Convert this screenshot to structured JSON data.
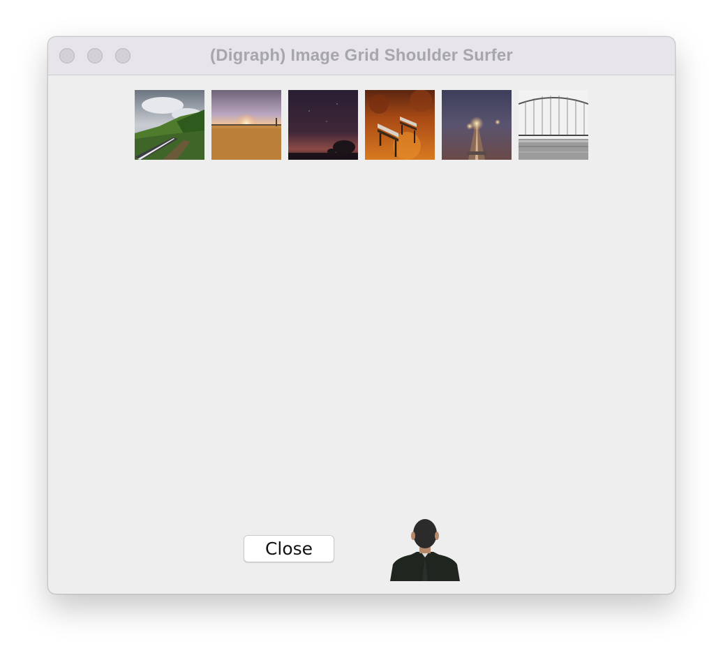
{
  "window": {
    "title": "(Digraph) Image Grid Shoulder Surfer"
  },
  "image_grid": {
    "images": [
      {
        "icon": "mountain-road-photo"
      },
      {
        "icon": "sunset-field-photo"
      },
      {
        "icon": "night-sky-tree-photo"
      },
      {
        "icon": "autumn-benches-photo"
      },
      {
        "icon": "foggy-road-lights-photo"
      },
      {
        "icon": "bridge-water-photo"
      }
    ]
  },
  "footer": {
    "close_label": "Close",
    "surfer_icon": "shoulder-surfer-person"
  },
  "colors": {
    "window_bg": "#eeeeee",
    "titlebar_bg": "#e7e4ea",
    "title_text": "#a7a6aa",
    "traffic_light": "#d3d1d5"
  }
}
